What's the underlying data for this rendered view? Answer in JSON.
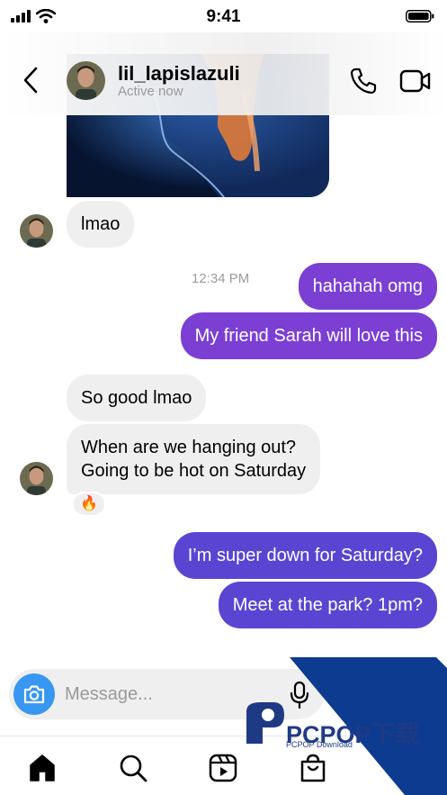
{
  "status_bar": {
    "time": "9:41"
  },
  "header": {
    "username": "lil_lapislazuli",
    "status": "Active now"
  },
  "messages": {
    "m1": "lmao",
    "timestamp": "12:34 PM",
    "m2": "hahahah omg",
    "m3": "My friend Sarah will love this",
    "m4": "So good lmao",
    "m5_line1": "When are we hanging out?",
    "m5_line2": "Going to be hot on Saturday",
    "reaction": "🔥",
    "m6": "I’m super down for Saturday?",
    "m7": "Meet at the park? 1pm?"
  },
  "composer": {
    "placeholder": "Message..."
  },
  "watermark": {
    "brand": "PCPOP下载",
    "sub": "PCPOP Download"
  },
  "colors": {
    "outgoing": "#7b3fd4",
    "outgoing_alt": "#5a45d2",
    "incoming": "#efefef",
    "camera": "#3897f0"
  },
  "icons": [
    "back-icon",
    "phone-icon",
    "video-camera-icon",
    "camera-icon",
    "microphone-icon",
    "home-icon",
    "search-icon",
    "reels-icon",
    "shop-icon"
  ]
}
